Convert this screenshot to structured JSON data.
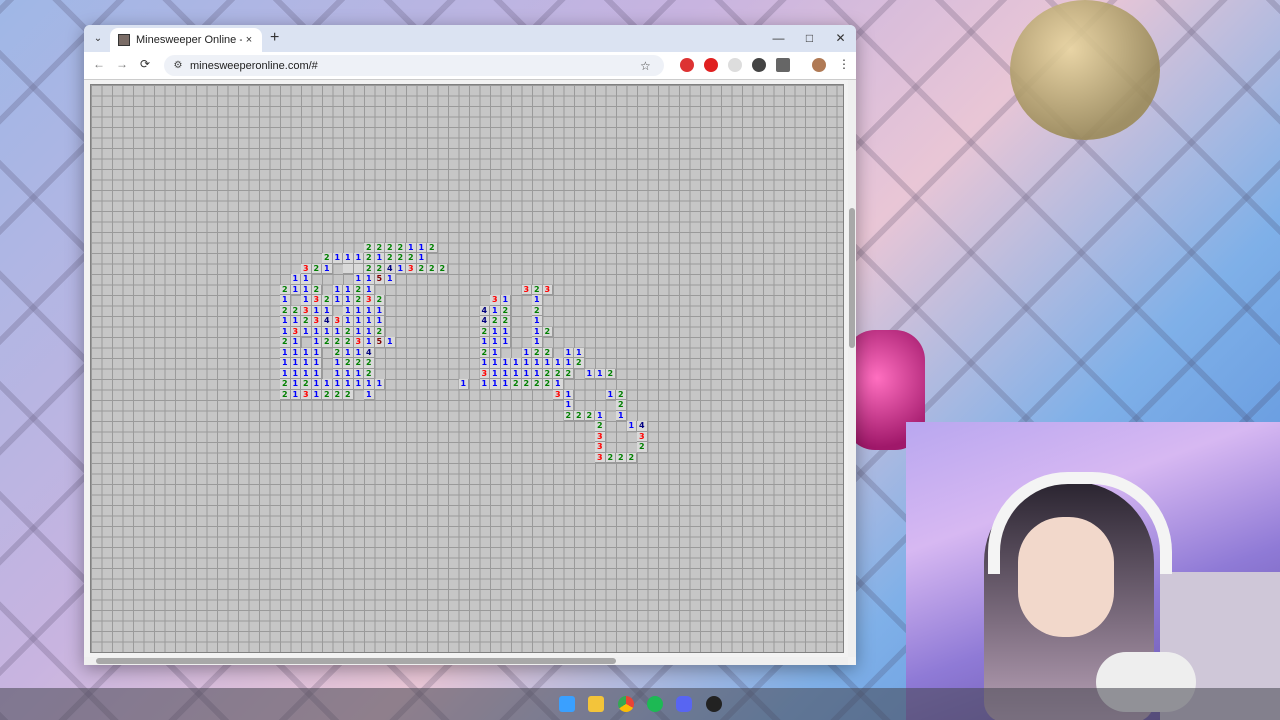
{
  "browser": {
    "tab_title": "Minesweeper Online - Play Fre",
    "url": "minesweeperonline.com/#",
    "tab_close": "×",
    "new_tab": "+",
    "chevron": "⌄",
    "back": "←",
    "forward": "→",
    "reload": "⟳",
    "star": "☆",
    "site_info": "⚙",
    "minimize": "—",
    "maximize": "□",
    "close": "✕",
    "menu": "⋮"
  },
  "game": {
    "colors": {
      "1": "#0000ff",
      "2": "#008000",
      "3": "#ff0000",
      "4": "#000080",
      "5": "#800000"
    },
    "revealed_rows": [
      {
        "r": 15,
        "c": 26,
        "v": "2222112"
      },
      {
        "r": 16,
        "c": 22,
        "v": "2111212221"
      },
      {
        "r": 17,
        "c": 20,
        "v": "321 ..22413222"
      },
      {
        "r": 18,
        "c": 19,
        "v": "11    1151"
      },
      {
        "r": 19,
        "c": 18,
        "v": "2112 1121"
      },
      {
        "r": 19,
        "c": 41,
        "v": "323"
      },
      {
        "r": 20,
        "c": 18,
        "v": "1 13211232"
      },
      {
        "r": 20,
        "c": 38,
        "v": "31  1"
      },
      {
        "r": 21,
        "c": 18,
        "v": "22311 1111"
      },
      {
        "r": 21,
        "c": 37,
        "v": "412  2"
      },
      {
        "r": 22,
        "c": 18,
        "v": "1123431111"
      },
      {
        "r": 22,
        "c": 37,
        "v": "422  1"
      },
      {
        "r": 23,
        "c": 18,
        "v": "1311112112"
      },
      {
        "r": 23,
        "c": 37,
        "v": "211  12"
      },
      {
        "r": 24,
        "c": 18,
        "v": "21 12223151"
      },
      {
        "r": 24,
        "c": 37,
        "v": "111  1"
      },
      {
        "r": 25,
        "c": 18,
        "v": "1111 2114"
      },
      {
        "r": 25,
        "c": 37,
        "v": "21  122 11"
      },
      {
        "r": 26,
        "c": 18,
        "v": "1111 1222"
      },
      {
        "r": 26,
        "c": 37,
        "v": "1111111112"
      },
      {
        "r": 27,
        "c": 18,
        "v": "1111 1112"
      },
      {
        "r": 27,
        "c": 37,
        "v": "311111222 112"
      },
      {
        "r": 28,
        "c": 18,
        "v": "2121111111"
      },
      {
        "r": 28,
        "c": 35,
        "v": "1 11122221"
      },
      {
        "r": 29,
        "c": 18,
        "v": "2131222 1"
      },
      {
        "r": 29,
        "c": 44,
        "v": "31   12"
      },
      {
        "r": 30,
        "c": 45,
        "v": "1    2"
      },
      {
        "r": 31,
        "c": 45,
        "v": "2221 1"
      },
      {
        "r": 32,
        "c": 48,
        "v": "2  14"
      },
      {
        "r": 33,
        "c": 48,
        "v": "3   3"
      },
      {
        "r": 34,
        "c": 48,
        "v": "3   2"
      },
      {
        "r": 35,
        "c": 48,
        "v": "3222"
      }
    ]
  },
  "taskbar": {
    "icons": [
      "windows-start-icon",
      "file-explorer-icon",
      "chrome-icon",
      "spotify-icon",
      "discord-icon",
      "obs-icon"
    ]
  }
}
